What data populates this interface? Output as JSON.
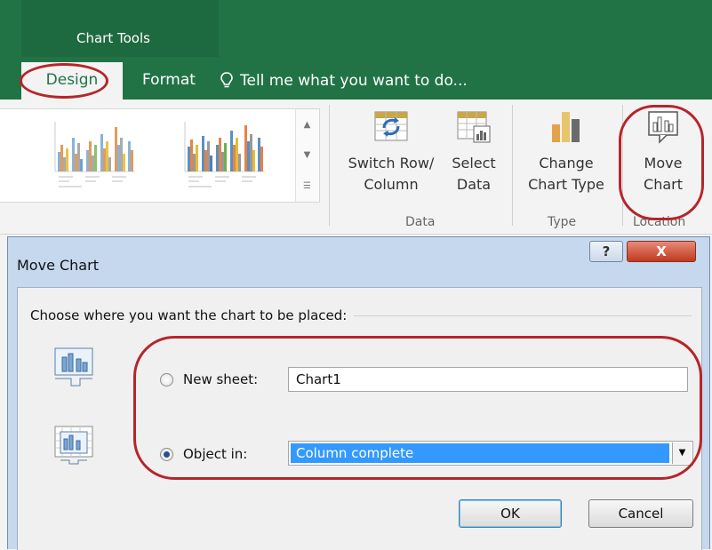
{
  "ribbon": {
    "context_group": "Chart Tools",
    "tabs": [
      {
        "label": "Design",
        "active": true
      },
      {
        "label": "Format",
        "active": false
      }
    ],
    "tell_me": "Tell me what you want to do...",
    "buttons": {
      "switch_row_column": "Switch Row/ Column",
      "switch_row_column_line1": "Switch Row/",
      "switch_row_column_line2": "Column",
      "select_data_line1": "Select",
      "select_data_line2": "Data",
      "change_chart_type_line1": "Change",
      "change_chart_type_line2": "Chart Type",
      "move_chart_line1": "Move",
      "move_chart_line2": "Chart"
    },
    "groups": {
      "data": "Data",
      "type": "Type",
      "location": "Location"
    },
    "icons": [
      "lightbulb-icon",
      "switch-row-column-icon",
      "select-data-icon",
      "change-chart-type-icon",
      "move-chart-icon"
    ]
  },
  "dialog": {
    "title": "Move Chart",
    "help_glyph": "?",
    "close_glyph": "X",
    "prompt": "Choose where you want the chart to be placed:",
    "options": {
      "new_sheet": {
        "label": "New sheet:",
        "value": "Chart1",
        "selected": false
      },
      "object_in": {
        "label": "Object in:",
        "value": "Column complete",
        "selected": true
      }
    },
    "ok_label": "OK",
    "cancel_label": "Cancel"
  },
  "colors": {
    "ribbon_green": "#217346",
    "highlight_oval": "#b5252a",
    "selection_blue": "#3399ff"
  }
}
